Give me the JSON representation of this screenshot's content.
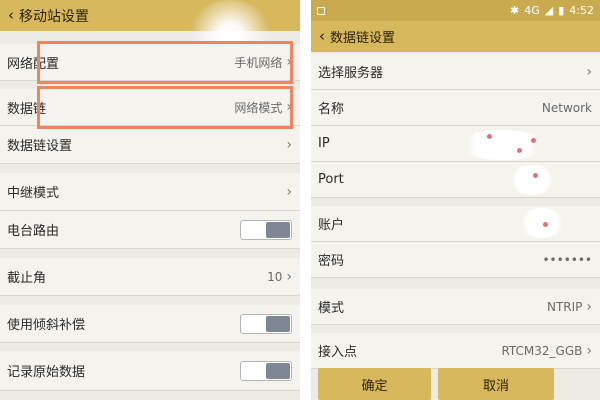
{
  "left": {
    "title": "移动站设置",
    "items": [
      {
        "label": "网络配置",
        "value": "手机网络"
      },
      {
        "label": "数据链",
        "value": "网络模式"
      },
      {
        "label": "数据链设置",
        "value": ""
      },
      {
        "label": "中继模式",
        "value": ""
      },
      {
        "label": "电台路由",
        "value": ""
      },
      {
        "label": "截止角",
        "value": "10"
      },
      {
        "label": "使用倾斜补偿",
        "value": ""
      },
      {
        "label": "记录原始数据",
        "value": ""
      }
    ]
  },
  "right": {
    "status": {
      "network": "4G",
      "time": "4:52"
    },
    "title": "数据链设置",
    "items": [
      {
        "label": "选择服务器",
        "value": ""
      },
      {
        "label": "名称",
        "value": "Network"
      },
      {
        "label": "IP",
        "value": ""
      },
      {
        "label": "Port",
        "value": ""
      },
      {
        "label": "账户",
        "value": ""
      },
      {
        "label": "密码",
        "value": "•••••••"
      },
      {
        "label": "模式",
        "value": "NTRIP"
      },
      {
        "label": "接入点",
        "value": "RTCM32_GGB"
      }
    ],
    "buttons": {
      "ok": "确定",
      "cancel": "取消"
    }
  },
  "colors": {
    "accent": "#d7b85d",
    "highlight": "#f0845c",
    "toggle_knob": "#7f8795"
  }
}
